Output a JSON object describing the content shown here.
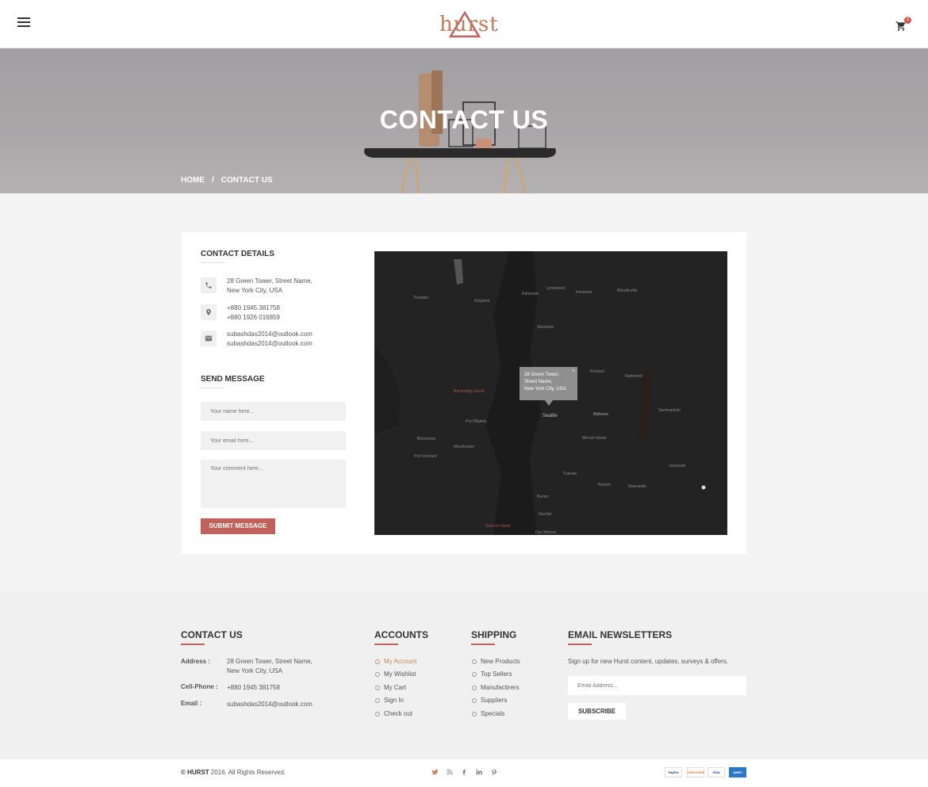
{
  "header": {
    "logo": "hurst",
    "cart_count": "2"
  },
  "hero": {
    "title": "CONTACT US",
    "breadcrumb": [
      "HOME",
      "/",
      "CONTACT US"
    ]
  },
  "contact_details": {
    "title": "CONTACT DETAILS",
    "address": [
      "28 Green Tower, Street Name,",
      "New York City, USA"
    ],
    "phones": [
      "+880 1945 381758",
      "+880 1926 016859"
    ],
    "emails": [
      "subashdas2014@outlook.com",
      "subashdas2014@outlook.com"
    ]
  },
  "send_message": {
    "title": "SEND MESSAGE",
    "name_placeholder": "Your name here...",
    "email_placeholder": "Your email here...",
    "comment_placeholder": "Your comment here...",
    "submit_label": "SUBMIT MESSAGE"
  },
  "map": {
    "popup": [
      "28 Green Tower,",
      "Street Name,",
      "New York City, USA"
    ],
    "close": "×",
    "labels": [
      "Seattle",
      "Bellevue",
      "Kirkland",
      "Redmond",
      "Mercer Island",
      "Bainbridge Island",
      "Vashon Island",
      "Burien",
      "Renton",
      "Issaquah",
      "Sammamish",
      "Bremerton",
      "Port Orchard",
      "Shoreline",
      "Edmonds",
      "Lynnwood",
      "Kenmore",
      "Woodinville",
      "Poulsbo",
      "Kingston",
      "Tukwila",
      "SeaTac",
      "Des Moines",
      "Newcastle",
      "Port Blakely",
      "Manchester"
    ]
  },
  "footer": {
    "contact": {
      "title": "CONTACT US",
      "address_label": "Address :",
      "address": [
        "28 Green Tower, Street Name,",
        "New York City, USA"
      ],
      "phone_label": "Cell-Phone :",
      "phone": "+880 1945 381758",
      "email_label": "Email :",
      "email": "subashdas2014@outlook.com"
    },
    "accounts": {
      "title": "ACCOUNTS",
      "links": [
        "My Account",
        "My Wishlist",
        "My Cart",
        "Sign In",
        "Check out"
      ]
    },
    "shipping": {
      "title": "SHIPPING",
      "links": [
        "New Products",
        "Top Sellers",
        "Manufactirers",
        "Suppliers",
        "Specials"
      ]
    },
    "newsletter": {
      "title": "EMAIL NEWSLETTERS",
      "text": "Sign up for new Hurst content, updates, surveys & offers.",
      "placeholder": "Email Address...",
      "button": "SUBSCRIBE"
    }
  },
  "bottom": {
    "copyright_brand": "© HURST",
    "copyright_rest": " 2016. All Rights Reserved.",
    "social": [
      "twitter-icon",
      "rss-icon",
      "facebook-icon",
      "linkedin-icon",
      "pinterest-icon"
    ],
    "payments": [
      "PayPal",
      "DISCOVER",
      "VISA",
      "AMEX"
    ]
  },
  "colors": {
    "accent": "#c0615a",
    "link_active": "#c8885f",
    "map_bg": "#232323"
  }
}
